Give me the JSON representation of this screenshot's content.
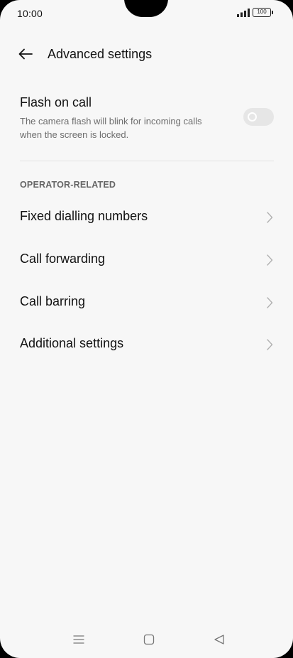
{
  "status_bar": {
    "time": "10:00",
    "battery": "100",
    "icons": [
      "signal-icon",
      "battery-icon"
    ]
  },
  "header": {
    "title": "Advanced settings",
    "back_icon": "arrow-left-icon"
  },
  "flash_on_call": {
    "title": "Flash on call",
    "description": "The camera flash will blink for incoming calls when the screen is locked.",
    "enabled": false
  },
  "section": {
    "header": "OPERATOR-RELATED"
  },
  "menu": {
    "items": [
      {
        "label": "Fixed dialling numbers"
      },
      {
        "label": "Call forwarding"
      },
      {
        "label": "Call barring"
      },
      {
        "label": "Additional settings"
      }
    ]
  },
  "nav": {
    "icons": [
      "menu-icon",
      "home-icon",
      "back-triangle-icon"
    ]
  },
  "colors": {
    "background": "#f7f7f7",
    "text_primary": "#111111",
    "text_secondary": "#6d6d6d",
    "toggle_off": "#e6e6e6",
    "chevron": "#b0b0b0"
  }
}
